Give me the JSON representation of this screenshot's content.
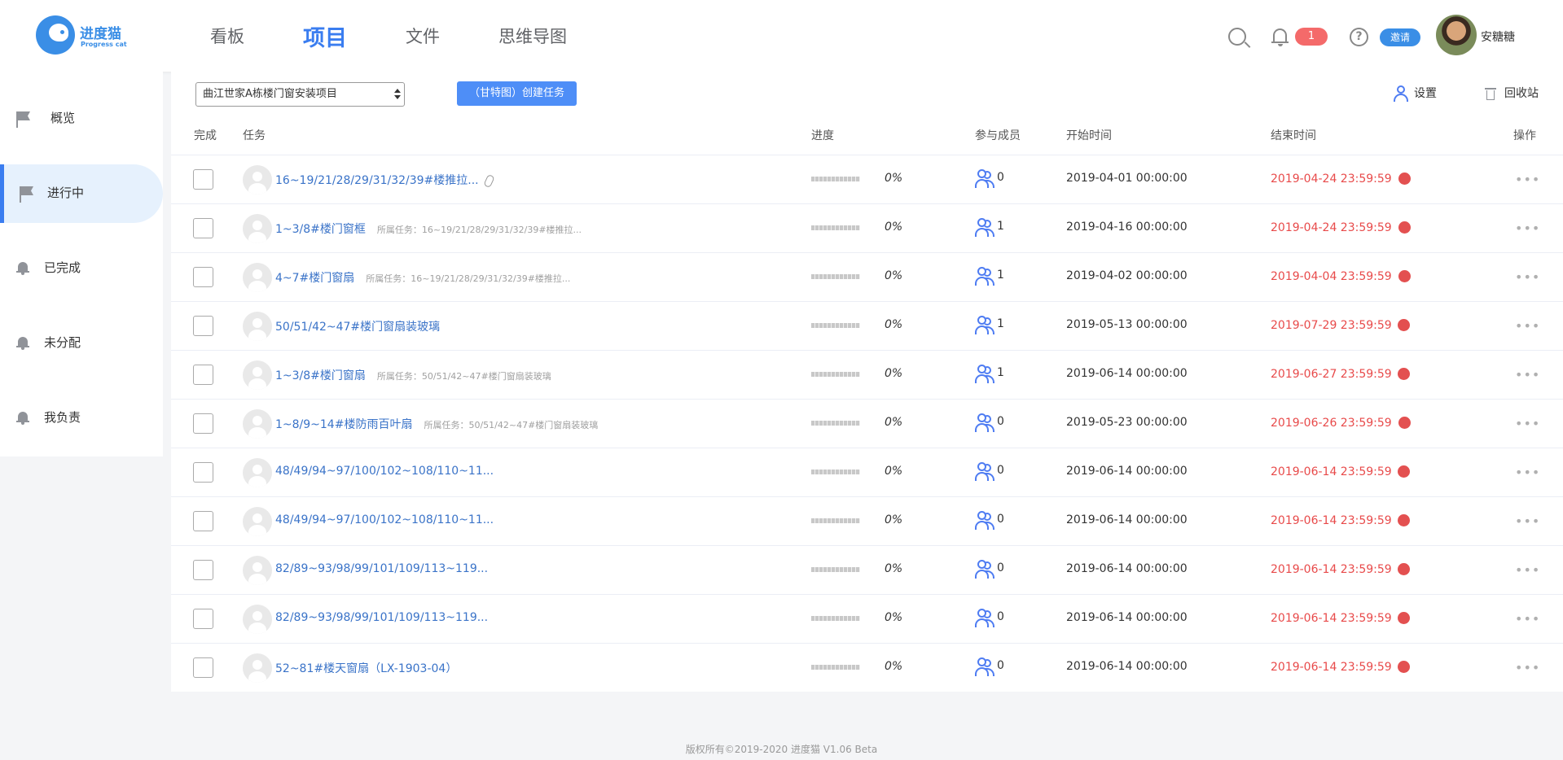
{
  "header": {
    "logo_cn": "进度猫",
    "logo_en": "Progress cat",
    "nav": [
      {
        "label": "看板"
      },
      {
        "label": "项目",
        "active": true
      },
      {
        "label": "文件"
      },
      {
        "label": "思维导图"
      }
    ],
    "notification_count": "1",
    "invite_label": "邀请",
    "user_name": "安糖糖"
  },
  "sidebar": {
    "items": [
      {
        "label": "概览",
        "icon": "flag-icon"
      },
      {
        "label": "进行中",
        "icon": "flag-icon",
        "active": true
      },
      {
        "label": "已完成",
        "icon": "bell-icon"
      },
      {
        "label": "未分配",
        "icon": "bell-icon"
      },
      {
        "label": "我负责",
        "icon": "bell-icon"
      }
    ]
  },
  "toolbar": {
    "project_select": "曲江世家A栋楼门窗安装项目",
    "gantt_button": "（甘特图）创建任务",
    "settings_label": "设置",
    "recycle_label": "回收站"
  },
  "table": {
    "headers": {
      "done": "完成",
      "task": "任务",
      "progress": "进度",
      "members": "参与成员",
      "start": "开始时间",
      "end": "结束时间",
      "actions": "操作"
    },
    "rows": [
      {
        "title": "16~19/21/28/29/31/32/39#楼推拉...",
        "parent": "",
        "attachment": true,
        "progress": "0%",
        "progress_value": 0,
        "members": "0",
        "start": "2019-04-01 00:00:00",
        "end": "2019-04-24 23:59:59"
      },
      {
        "title": "1~3/8#楼门窗框",
        "parent": "所属任务：16~19/21/28/29/31/32/39#楼推拉...",
        "attachment": false,
        "progress": "0%",
        "progress_value": 0,
        "members": "1",
        "start": "2019-04-16 00:00:00",
        "end": "2019-04-24 23:59:59"
      },
      {
        "title": "4~7#楼门窗扇",
        "parent": "所属任务：16~19/21/28/29/31/32/39#楼推拉...",
        "attachment": false,
        "progress": "0%",
        "progress_value": 0,
        "members": "1",
        "start": "2019-04-02 00:00:00",
        "end": "2019-04-04 23:59:59"
      },
      {
        "title": "50/51/42~47#楼门窗扇装玻璃",
        "parent": "",
        "attachment": false,
        "progress": "0%",
        "progress_value": 0,
        "members": "1",
        "start": "2019-05-13 00:00:00",
        "end": "2019-07-29 23:59:59"
      },
      {
        "title": "1~3/8#楼门窗扇",
        "parent": "所属任务：50/51/42~47#楼门窗扇装玻璃",
        "attachment": false,
        "progress": "0%",
        "progress_value": 0,
        "members": "1",
        "start": "2019-06-14 00:00:00",
        "end": "2019-06-27 23:59:59"
      },
      {
        "title": "1~8/9~14#楼防雨百叶扇",
        "parent": "所属任务：50/51/42~47#楼门窗扇装玻璃",
        "attachment": false,
        "progress": "0%",
        "progress_value": 0,
        "members": "0",
        "start": "2019-05-23 00:00:00",
        "end": "2019-06-26 23:59:59"
      },
      {
        "title": "48/49/94~97/100/102~108/110~11...",
        "parent": "",
        "attachment": false,
        "progress": "0%",
        "progress_value": 0,
        "members": "0",
        "start": "2019-06-14 00:00:00",
        "end": "2019-06-14 23:59:59"
      },
      {
        "title": "48/49/94~97/100/102~108/110~11...",
        "parent": "",
        "attachment": false,
        "progress": "0%",
        "progress_value": 0,
        "members": "0",
        "start": "2019-06-14 00:00:00",
        "end": "2019-06-14 23:59:59"
      },
      {
        "title": "82/89~93/98/99/101/109/113~119...",
        "parent": "",
        "attachment": false,
        "progress": "0%",
        "progress_value": 0,
        "members": "0",
        "start": "2019-06-14 00:00:00",
        "end": "2019-06-14 23:59:59"
      },
      {
        "title": "82/89~93/98/99/101/109/113~119...",
        "parent": "",
        "attachment": false,
        "progress": "0%",
        "progress_value": 0,
        "members": "0",
        "start": "2019-06-14 00:00:00",
        "end": "2019-06-14 23:59:59"
      },
      {
        "title": "52~81#楼天窗扇（LX-1903-04）",
        "parent": "",
        "attachment": false,
        "progress": "0%",
        "progress_value": 0,
        "members": "0",
        "start": "2019-06-14 00:00:00",
        "end": "2019-06-14 23:59:59"
      }
    ]
  },
  "footer": {
    "text": "版权所有©2019-2020 进度猫 V1.06 Beta"
  },
  "colors": {
    "accent": "#3a7df0",
    "link": "#3a73c8",
    "overdue": "#e84a4a",
    "badge": "#f46a6a"
  }
}
